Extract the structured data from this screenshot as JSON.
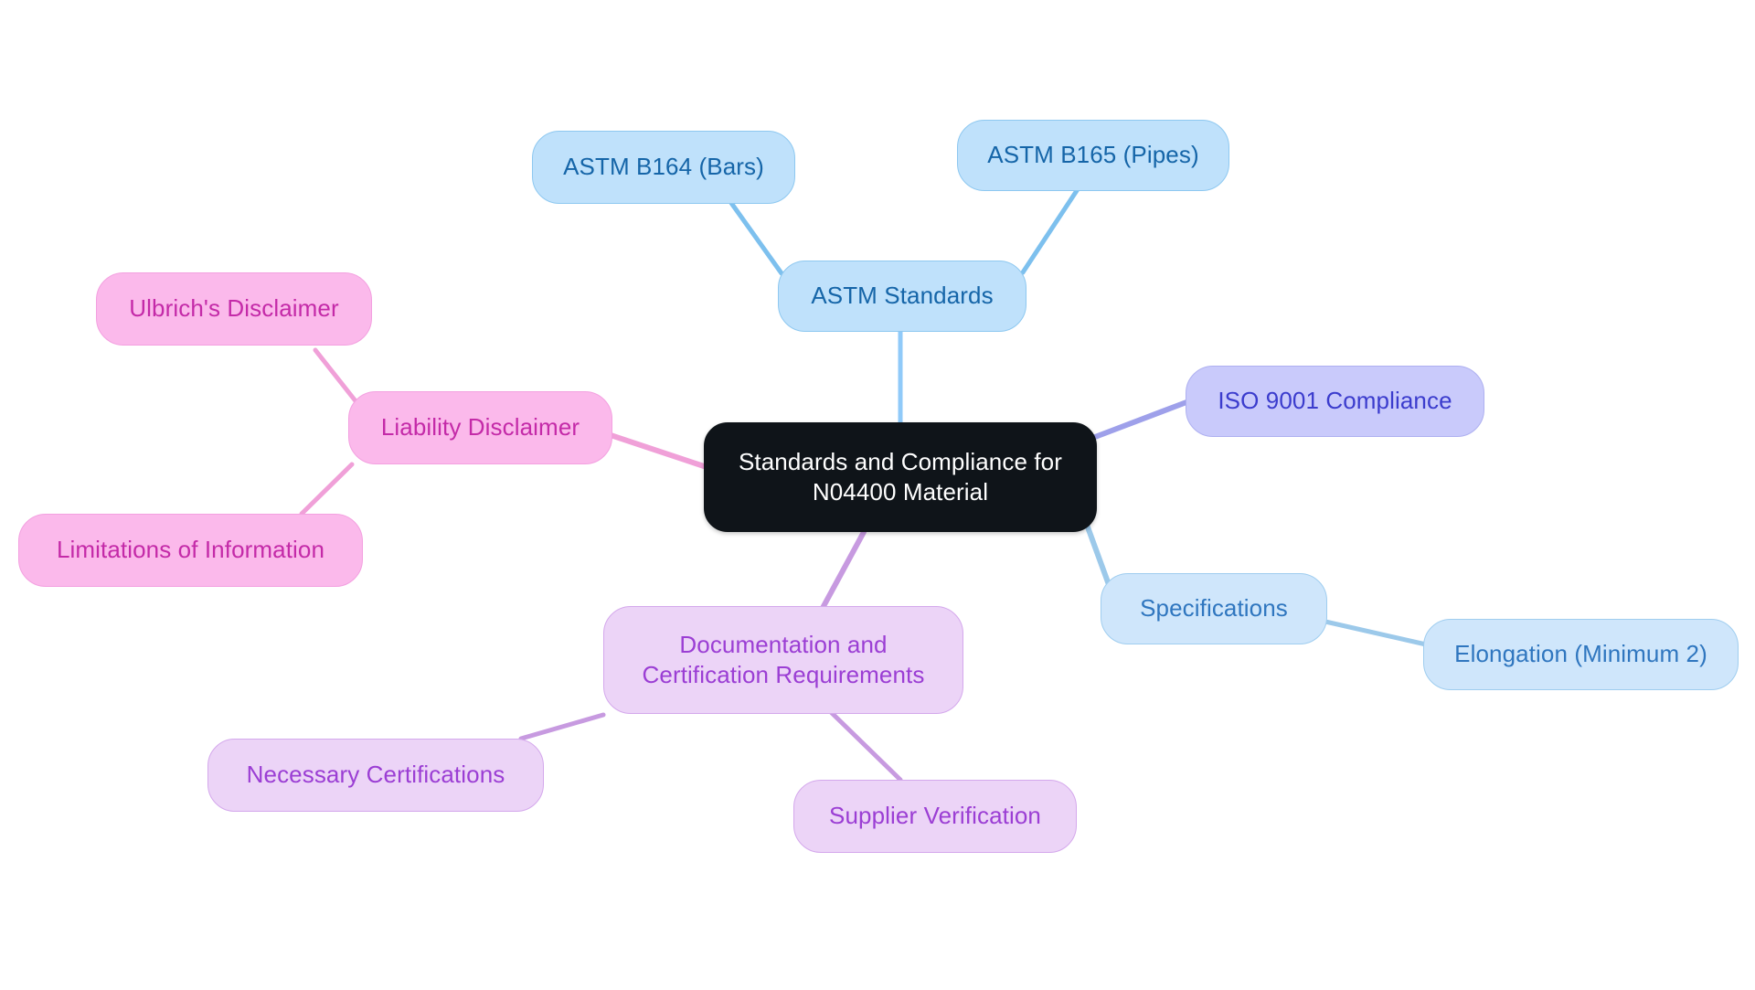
{
  "diagram": {
    "type": "mindmap",
    "background": "#ffffff",
    "root": {
      "id": "root",
      "label": "Standards and Compliance for\nN04400 Material",
      "fill": "#0f1419",
      "text_color": "#ffffff"
    },
    "branches": [
      {
        "id": "astm-standards",
        "label": "ASTM Standards",
        "fill": "#bfe1fb",
        "text_color": "#1565a8",
        "edge_color": "#90caf9",
        "children": [
          {
            "id": "astm-b164",
            "label": "ASTM B164 (Bars)",
            "fill": "#bfe1fb",
            "text_color": "#1565a8"
          },
          {
            "id": "astm-b165",
            "label": "ASTM B165 (Pipes)",
            "fill": "#bfe1fb",
            "text_color": "#1565a8"
          }
        ]
      },
      {
        "id": "iso-9001-compliance",
        "label": "ISO 9001 Compliance",
        "fill": "#c9cafb",
        "text_color": "#3b3ccd",
        "edge_color": "#9ea0ea",
        "children": []
      },
      {
        "id": "specifications",
        "label": "Specifications",
        "fill": "#cfe6fb",
        "text_color": "#2f76bf",
        "edge_color": "#9cc9ea",
        "children": [
          {
            "id": "elongation",
            "label": "Elongation (Minimum 2)",
            "fill": "#cfe6fb",
            "text_color": "#3b82c4"
          }
        ]
      },
      {
        "id": "documentation-certification",
        "label": "Documentation and\nCertification Requirements",
        "fill": "#ecd4f7",
        "text_color": "#9b3ed4",
        "edge_color": "#c79ae0",
        "children": [
          {
            "id": "necessary-certifications",
            "label": "Necessary Certifications",
            "fill": "#ecd4f7",
            "text_color": "#9b3ed4"
          },
          {
            "id": "supplier-verification",
            "label": "Supplier Verification",
            "fill": "#ecd4f7",
            "text_color": "#9b3ed4"
          }
        ]
      },
      {
        "id": "liability-disclaimer",
        "label": "Liability Disclaimer",
        "fill": "#fbb9eb",
        "text_color": "#c42aa8",
        "edge_color": "#f0a0d8",
        "children": [
          {
            "id": "ulbrichs-disclaimer",
            "label": "Ulbrich's Disclaimer",
            "fill": "#fbb9eb",
            "text_color": "#c42aa8"
          },
          {
            "id": "limitations-of-information",
            "label": "Limitations of Information",
            "fill": "#fbb9eb",
            "text_color": "#c42aa8"
          }
        ]
      }
    ]
  },
  "nodes": {
    "root": "Standards and Compliance for\nN04400 Material",
    "astm_b164": "ASTM B164 (Bars)",
    "astm_b165": "ASTM B165 (Pipes)",
    "astm_standards": "ASTM Standards",
    "iso_9001": "ISO 9001 Compliance",
    "specifications": "Specifications",
    "elongation": "Elongation (Minimum 2)",
    "documentation": "Documentation and\nCertification Requirements",
    "necessary_certifications": "Necessary Certifications",
    "supplier_verification": "Supplier Verification",
    "liability_disclaimer": "Liability Disclaimer",
    "ulbrichs_disclaimer": "Ulbrich's Disclaimer",
    "limitations_of_information": "Limitations of Information"
  }
}
